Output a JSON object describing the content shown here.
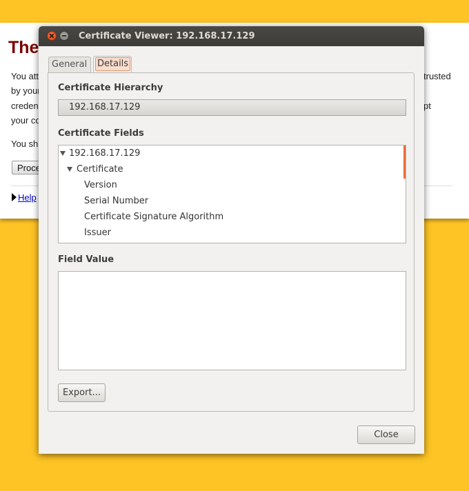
{
  "background_page": {
    "title": "The",
    "lines": [
      {
        "text": "You att",
        "right": "trusted"
      },
      {
        "text": "by your",
        "right": ""
      },
      {
        "text": "creden",
        "right": "pt"
      },
      {
        "text": "your co",
        "right": ""
      }
    ],
    "line_you_should": "You sh",
    "proceed_button": "Proce",
    "help_link": "Help"
  },
  "dialog": {
    "title": "Certificate Viewer: 192.168.17.129",
    "tabs": [
      {
        "label": "General",
        "selected": false
      },
      {
        "label": "Details",
        "selected": true
      }
    ],
    "hierarchy_label": "Certificate Hierarchy",
    "hierarchy_value": "192.168.17.129",
    "fields_label": "Certificate Fields",
    "fields_tree": [
      {
        "label": "192.168.17.129",
        "level": 0,
        "expanded": true
      },
      {
        "label": "Certificate",
        "level": 1,
        "expanded": true
      },
      {
        "label": "Version",
        "level": 2
      },
      {
        "label": "Serial Number",
        "level": 2
      },
      {
        "label": "Certificate Signature Algorithm",
        "level": 2
      },
      {
        "label": "Issuer",
        "level": 2
      }
    ],
    "field_value_label": "Field Value",
    "field_value": "",
    "export_button": "Export...",
    "close_button": "Close"
  },
  "colors": {
    "desktop_bg": "#fec425",
    "titlebar": "#3c3b37",
    "close_btn": "#d8441b",
    "selected_tab_highlight": "#f8dccd",
    "scroll_indicator": "#e76f3b"
  },
  "icons": {
    "window_close": "close-icon",
    "window_minimize": "minimize-icon",
    "tree_expander": "triangle-down-icon",
    "help_expander": "triangle-right-icon"
  }
}
